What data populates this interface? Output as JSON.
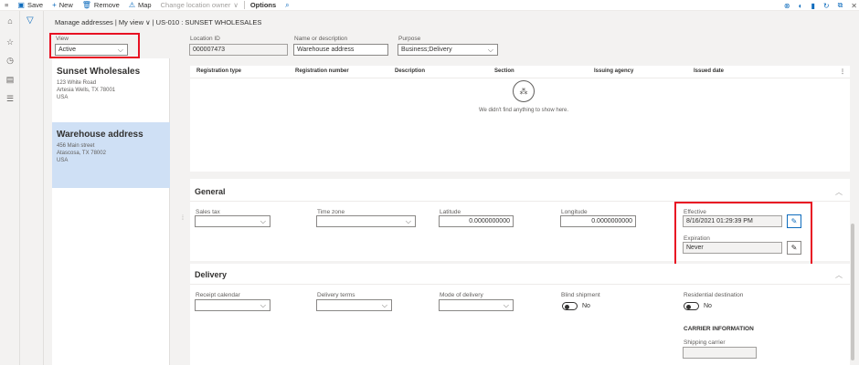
{
  "toolbar": {
    "save": "Save",
    "new": "New",
    "remove": "Remove",
    "map": "Map",
    "change_location_owner": "Change location owner",
    "options": "Options"
  },
  "breadcrumb": "Manage addresses  |  My view ∨  |  US-010 : SUNSET WHOLESALES",
  "view": {
    "label": "View",
    "value": "Active"
  },
  "addresses": [
    {
      "name": "Sunset Wholesales",
      "line1": "123 White Road",
      "line2": "Artesia Wells, TX 78001",
      "line3": "USA"
    },
    {
      "name": "Warehouse address",
      "line1": "456 Main street",
      "line2": "Atascosa, TX 78002",
      "line3": "USA"
    }
  ],
  "header": {
    "location_id_label": "Location ID",
    "location_id": "000007473",
    "name_label": "Name or description",
    "name": "Warehouse address",
    "purpose_label": "Purpose",
    "purpose": "Business;Delivery"
  },
  "grid": {
    "columns": [
      "Registration type",
      "Registration number",
      "Description",
      "Section",
      "Issuing agency",
      "Issued date"
    ],
    "empty_message": "We didn't find anything to show here."
  },
  "general": {
    "title": "General",
    "sales_tax_label": "Sales tax",
    "time_zone_label": "Time zone",
    "latitude_label": "Latitude",
    "latitude": "0.0000000000",
    "longitude_label": "Longitude",
    "longitude": "0.0000000000",
    "effective_label": "Effective",
    "effective": "8/16/2021 01:29:39 PM",
    "expiration_label": "Expiration",
    "expiration": "Never"
  },
  "delivery": {
    "title": "Delivery",
    "receipt_calendar_label": "Receipt calendar",
    "delivery_terms_label": "Delivery terms",
    "mode_of_delivery_label": "Mode of delivery",
    "blind_shipment_label": "Blind shipment",
    "blind_shipment_value": "No",
    "residential_label": "Residential destination",
    "residential_value": "No",
    "carrier_heading": "CARRIER INFORMATION",
    "shipping_carrier_label": "Shipping carrier"
  },
  "colors": {
    "accent": "#0f6cbd",
    "highlight": "#e81123",
    "selected": "#cfe0f5"
  }
}
